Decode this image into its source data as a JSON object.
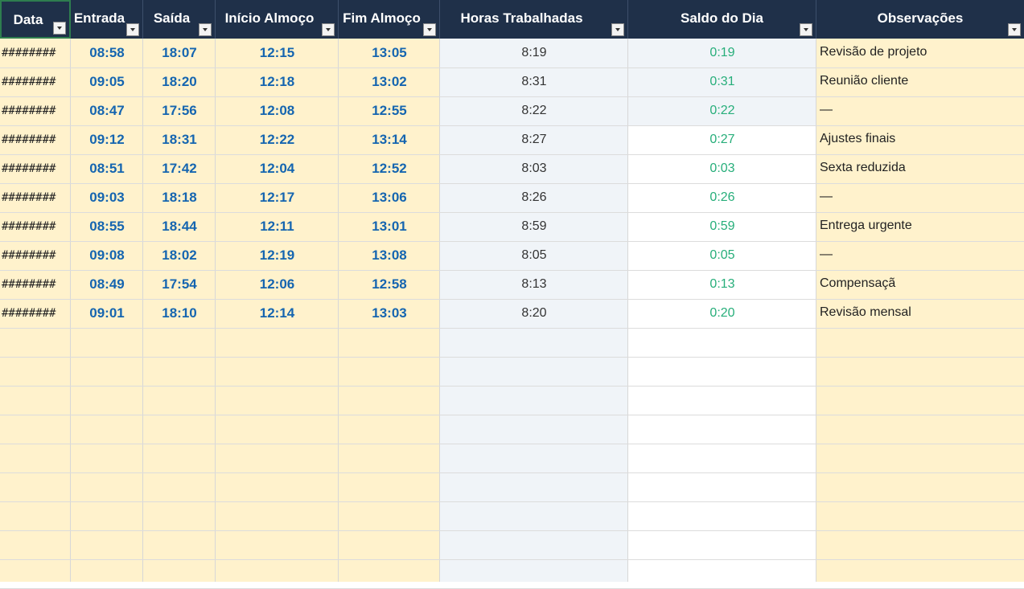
{
  "columns": [
    {
      "key": "data",
      "label": "Data"
    },
    {
      "key": "entrada",
      "label": "Entrada"
    },
    {
      "key": "saida",
      "label": "Saída"
    },
    {
      "key": "inicio_almoco",
      "label": "Início Almoço"
    },
    {
      "key": "fim_almoco",
      "label": "Fim Almoço"
    },
    {
      "key": "horas",
      "label": "Horas Trabalhadas"
    },
    {
      "key": "saldo",
      "label": "Saldo do Dia"
    },
    {
      "key": "obs",
      "label": "Observações"
    }
  ],
  "rows": [
    {
      "data": "########",
      "entrada": "08:58",
      "saida": "18:07",
      "inicio_almoco": "12:15",
      "fim_almoco": "13:05",
      "horas": "8:19",
      "saldo": "0:19",
      "obs": "Revisão de projeto"
    },
    {
      "data": "########",
      "entrada": "09:05",
      "saida": "18:20",
      "inicio_almoco": "12:18",
      "fim_almoco": "13:02",
      "horas": "8:31",
      "saldo": "0:31",
      "obs": "Reunião cliente"
    },
    {
      "data": "########",
      "entrada": "08:47",
      "saida": "17:56",
      "inicio_almoco": "12:08",
      "fim_almoco": "12:55",
      "horas": "8:22",
      "saldo": "0:22",
      "obs": "—"
    },
    {
      "data": "########",
      "entrada": "09:12",
      "saida": "18:31",
      "inicio_almoco": "12:22",
      "fim_almoco": "13:14",
      "horas": "8:27",
      "saldo": "0:27",
      "obs": "Ajustes finais"
    },
    {
      "data": "########",
      "entrada": "08:51",
      "saida": "17:42",
      "inicio_almoco": "12:04",
      "fim_almoco": "12:52",
      "horas": "8:03",
      "saldo": "0:03",
      "obs": "Sexta reduzida"
    },
    {
      "data": "########",
      "entrada": "09:03",
      "saida": "18:18",
      "inicio_almoco": "12:17",
      "fim_almoco": "13:06",
      "horas": "8:26",
      "saldo": "0:26",
      "obs": "—"
    },
    {
      "data": "########",
      "entrada": "08:55",
      "saida": "18:44",
      "inicio_almoco": "12:11",
      "fim_almoco": "13:01",
      "horas": "8:59",
      "saldo": "0:59",
      "obs": "Entrega urgente"
    },
    {
      "data": "########",
      "entrada": "09:08",
      "saida": "18:02",
      "inicio_almoco": "12:19",
      "fim_almoco": "13:08",
      "horas": "8:05",
      "saldo": "0:05",
      "obs": "—"
    },
    {
      "data": "########",
      "entrada": "08:49",
      "saida": "17:54",
      "inicio_almoco": "12:06",
      "fim_almoco": "12:58",
      "horas": "8:13",
      "saldo": "0:13",
      "obs": "Compensaçã"
    },
    {
      "data": "########",
      "entrada": "09:01",
      "saida": "18:10",
      "inicio_almoco": "12:14",
      "fim_almoco": "13:03",
      "horas": "8:20",
      "saldo": "0:20",
      "obs": "Revisão mensal"
    }
  ],
  "colors": {
    "header_bg": "#1f3049",
    "time_text": "#1565b0",
    "saldo_text": "#27ae7a",
    "input_fill": "#fff2cc",
    "calc_fill": "#f0f4f8",
    "obs_fill": "#fff2cc"
  }
}
